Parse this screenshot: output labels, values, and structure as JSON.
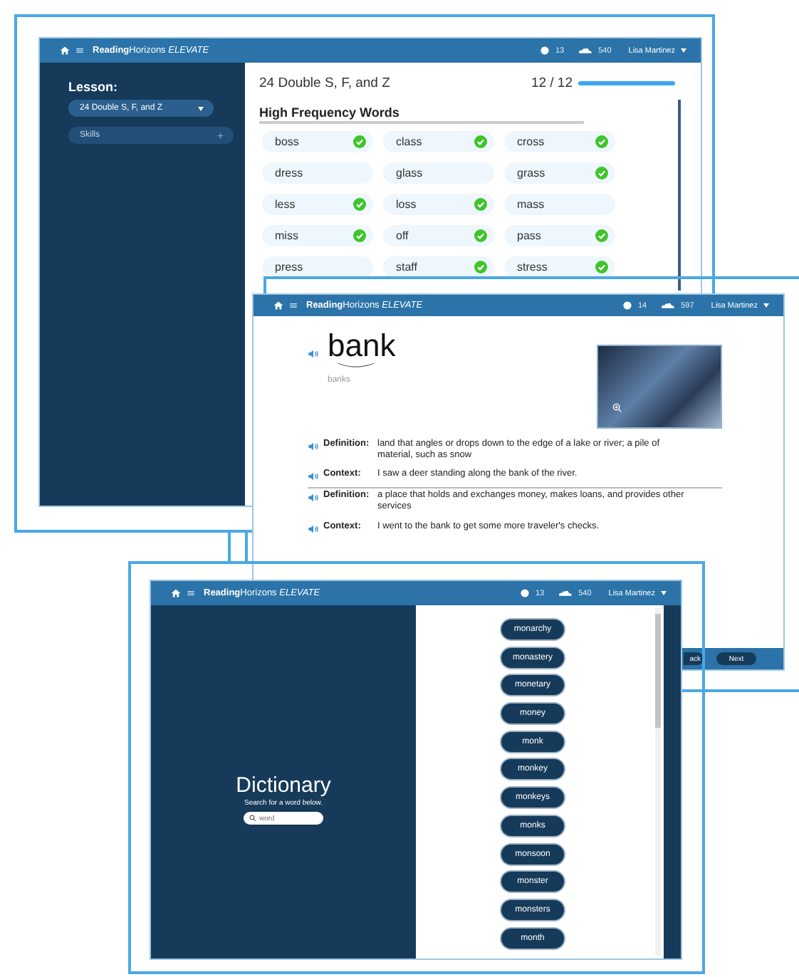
{
  "lesson_window": {
    "header": {
      "logo": "**Reading**Horizons *ELEVATE*",
      "stats": [
        {
          "kind": "coin",
          "value": "13"
        },
        {
          "kind": "cloud",
          "value": "540"
        }
      ],
      "user": "Lisa Martinez"
    },
    "sidebar": {
      "label": "Lesson:",
      "lesson_dropdown": "24 Double S, F, and Z",
      "skills_item": {
        "label": "Skills",
        "expand_icon": "+"
      }
    },
    "content": {
      "title": "24 Double S, F, and Z",
      "progress": {
        "text": "12 / 12",
        "level": 1
      },
      "section_title": "High Frequency Words",
      "words": [
        {
          "word": "boss",
          "checked": true
        },
        {
          "word": "class",
          "checked": true
        },
        {
          "word": "cross",
          "checked": true
        },
        {
          "word": "dress",
          "checked": false
        },
        {
          "word": "glass",
          "checked": false
        },
        {
          "word": "grass",
          "checked": true
        },
        {
          "word": "less",
          "checked": true
        },
        {
          "word": "loss",
          "checked": true
        },
        {
          "word": "mass",
          "checked": false
        },
        {
          "word": "miss",
          "checked": true
        },
        {
          "word": "off",
          "checked": true
        },
        {
          "word": "pass",
          "checked": true
        },
        {
          "word": "press",
          "checked": false
        },
        {
          "word": "staff",
          "checked": true
        },
        {
          "word": "stress",
          "checked": true
        }
      ]
    }
  },
  "word_window": {
    "header": {
      "logo": "**Reading**Horizons *ELEVATE*",
      "stats": [
        {
          "kind": "coin",
          "value": "14"
        },
        {
          "kind": "cloud",
          "value": "597"
        }
      ],
      "user": "Lisa Martinez"
    },
    "word": "bank",
    "plural": "banks",
    "entries": [
      {
        "kind": "definition",
        "label": "Definition:",
        "text": "land that angles or drops down to the edge of a lake or river; a pile of material, such as snow"
      },
      {
        "kind": "context",
        "label": "Context:",
        "text": "I saw a deer standing along the bank of the river."
      },
      {
        "kind": "definition",
        "label": "Definition:",
        "text": "a place that holds and exchanges money, makes loans, and provides other services"
      },
      {
        "kind": "context",
        "label": "Context:",
        "text": "I went to the bank to get some more traveler's checks."
      }
    ],
    "buttons": [
      "ack",
      "Next"
    ]
  },
  "dictionary_window": {
    "header": {
      "logo": "**Reading**Horizons *ELEVATE*",
      "stats": [
        {
          "kind": "coin",
          "value": "13"
        },
        {
          "kind": "cloud",
          "value": "540"
        }
      ],
      "user": "Lisa Martinez"
    },
    "title": "Dictionary",
    "subtitle": "Search for a word below.",
    "search": {
      "placeholder": "word"
    },
    "results": [
      "monarchy",
      "monastery",
      "monetary",
      "money",
      "monk",
      "monkey",
      "monkeys",
      "monks",
      "monsoon",
      "monster",
      "monsters",
      "month"
    ]
  }
}
